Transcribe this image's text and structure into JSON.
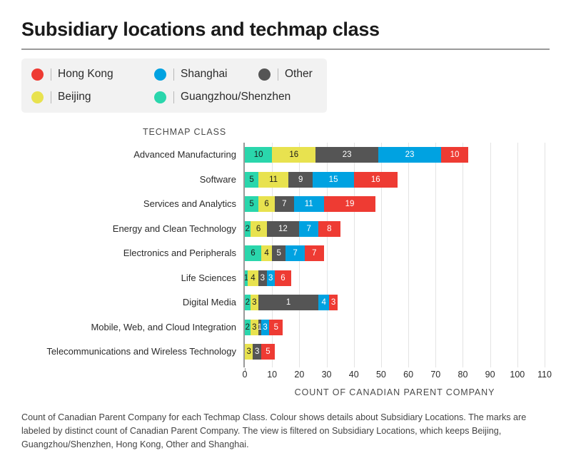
{
  "header": {
    "title": "Subsidiary locations and techmap class"
  },
  "legend": {
    "items": [
      {
        "label": "Hong Kong",
        "color": "#ee3b33",
        "row": 1,
        "col": 1
      },
      {
        "label": "Shanghai",
        "color": "#00a2e1",
        "row": 1,
        "col": 2
      },
      {
        "label": "Other",
        "color": "#555555",
        "row": 1,
        "col": 3
      },
      {
        "label": "Beijing",
        "color": "#e8e24f",
        "row": 2,
        "col": 1
      },
      {
        "label": "Guangzhou/Shenzhen",
        "color": "#2ad6ac",
        "row": 2,
        "col": 2
      }
    ]
  },
  "axes": {
    "y_title": "TECHMAP CLASS",
    "x_title": "COUNT OF CANADIAN PARENT COMPANY"
  },
  "caption": "Count of Canadian Parent Company for each Techmap Class. Colour shows details about Subsidiary Locations. The marks are labeled by distinct count of Canadian Parent Company. The view is filtered on Subsidiary Locations, which keeps Beijing, Guangzhou/Shenzhen, Hong Kong, Other and Shanghai.",
  "chart_data": {
    "type": "bar",
    "orientation": "horizontal",
    "stacked": true,
    "title": "Subsidiary locations and techmap class",
    "xlabel": "COUNT OF CANADIAN PARENT COMPANY",
    "ylabel": "TECHMAP CLASS",
    "xlim": [
      0,
      110
    ],
    "xticks": [
      0,
      10,
      20,
      30,
      40,
      50,
      60,
      70,
      80,
      90,
      100,
      110
    ],
    "grid": true,
    "legend_position": "top-left",
    "series_order": [
      "Guangzhou/Shenzhen",
      "Beijing",
      "Other",
      "Shanghai",
      "Hong Kong"
    ],
    "colors": {
      "Guangzhou/Shenzhen": "#2ad6ac",
      "Beijing": "#e8e24f",
      "Other": "#555555",
      "Shanghai": "#00a2e1",
      "Hong Kong": "#ee3b33"
    },
    "label_colors": {
      "Guangzhou/Shenzhen": "#1a1a1a",
      "Beijing": "#1a1a1a",
      "Other": "#ffffff",
      "Shanghai": "#ffffff",
      "Hong Kong": "#ffffff"
    },
    "categories": [
      "Advanced Manufacturing",
      "Software",
      "Services and Analytics",
      "Energy and Clean Technology",
      "Electronics and Peripherals",
      "Life Sciences",
      "Digital Media",
      "Mobile, Web, and Cloud Integration",
      "Telecommunications and Wireless Technology"
    ],
    "series": [
      {
        "name": "Guangzhou/Shenzhen",
        "values": [
          10,
          5,
          5,
          2,
          6,
          1,
          2,
          2,
          0
        ]
      },
      {
        "name": "Beijing",
        "values": [
          16,
          11,
          6,
          6,
          4,
          4,
          3,
          3,
          3
        ]
      },
      {
        "name": "Other",
        "values": [
          23,
          9,
          7,
          12,
          5,
          3,
          22,
          1,
          3
        ]
      },
      {
        "name": "Shanghai",
        "values": [
          23,
          15,
          11,
          7,
          7,
          3,
          4,
          3,
          0
        ]
      },
      {
        "name": "Hong Kong",
        "values": [
          10,
          16,
          19,
          8,
          7,
          6,
          3,
          5,
          5
        ]
      }
    ],
    "bar_labels": [
      [
        "10",
        "16",
        "23",
        "23",
        "10"
      ],
      [
        "5",
        "11",
        "9",
        "15",
        "16"
      ],
      [
        "5",
        "6",
        "7",
        "11",
        "19"
      ],
      [
        "2",
        "6",
        "12",
        "7",
        "8"
      ],
      [
        "6",
        "4",
        "5",
        "7",
        "7"
      ],
      [
        "1",
        "4",
        "3",
        "3",
        "6"
      ],
      [
        "2",
        "3",
        "1",
        "4",
        "3"
      ],
      [
        "2",
        "3",
        "1",
        "3",
        "5"
      ],
      [
        "",
        "3",
        "3",
        "",
        "5"
      ]
    ],
    "totals": [
      82,
      56,
      48,
      35,
      29,
      17,
      34,
      14,
      11
    ]
  }
}
